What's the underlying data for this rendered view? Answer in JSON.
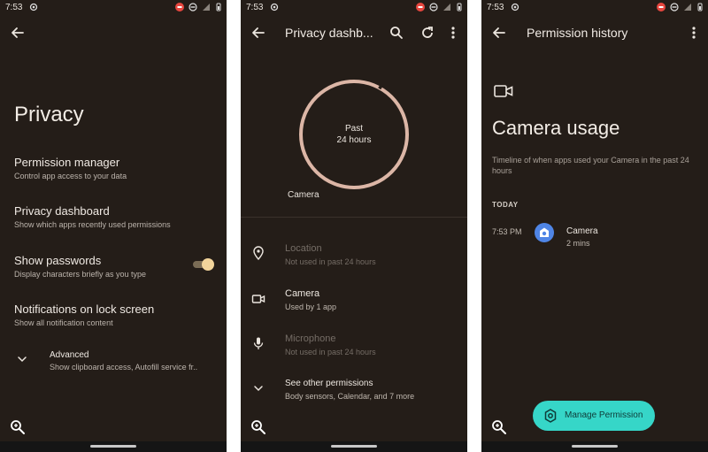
{
  "status_bar": {
    "time": "7:53"
  },
  "colors": {
    "background": "#241d18",
    "ring": "#dcb6a6",
    "toggle_knob": "#f2d49b",
    "fab": "#36d6c8",
    "app_icon": "#4f85e6"
  },
  "screens": [
    {
      "title": "Privacy",
      "settings": [
        {
          "title": "Permission manager",
          "subtitle": "Control app access to your data"
        },
        {
          "title": "Privacy dashboard",
          "subtitle": "Show which apps recently used permissions"
        },
        {
          "title": "Show passwords",
          "subtitle": "Display characters briefly as you type"
        },
        {
          "title": "Notifications on lock screen",
          "subtitle": "Show all notification content"
        },
        {
          "title": "Advanced",
          "subtitle": "Show clipboard access, Autofill service fr.."
        }
      ],
      "show_passwords_enabled": true
    },
    {
      "title": "Privacy dashb...",
      "ring_label_1": "Past",
      "ring_label_2": "24 hours",
      "ring_segment_label": "Camera",
      "permissions": [
        {
          "title": "Location",
          "subtitle": "Not used in past 24 hours",
          "icon": "location-pin-icon"
        },
        {
          "title": "Camera",
          "subtitle": "Used by 1 app",
          "icon": "camera-icon"
        },
        {
          "title": "Microphone",
          "subtitle": "Not used in past 24 hours",
          "icon": "microphone-icon"
        },
        {
          "title": "See other permissions",
          "subtitle": "Body sensors, Calendar, and 7 more",
          "icon": "chevron-down-icon"
        }
      ]
    },
    {
      "title": "Permission history",
      "usage_title": "Camera usage",
      "usage_subtitle": "Timeline of when apps used your Camera in the past 24 hours",
      "section": "TODAY",
      "history": [
        {
          "time": "7:53 PM",
          "app": "Camera",
          "duration": "2 mins"
        }
      ],
      "fab_label": "Manage Permission"
    }
  ]
}
